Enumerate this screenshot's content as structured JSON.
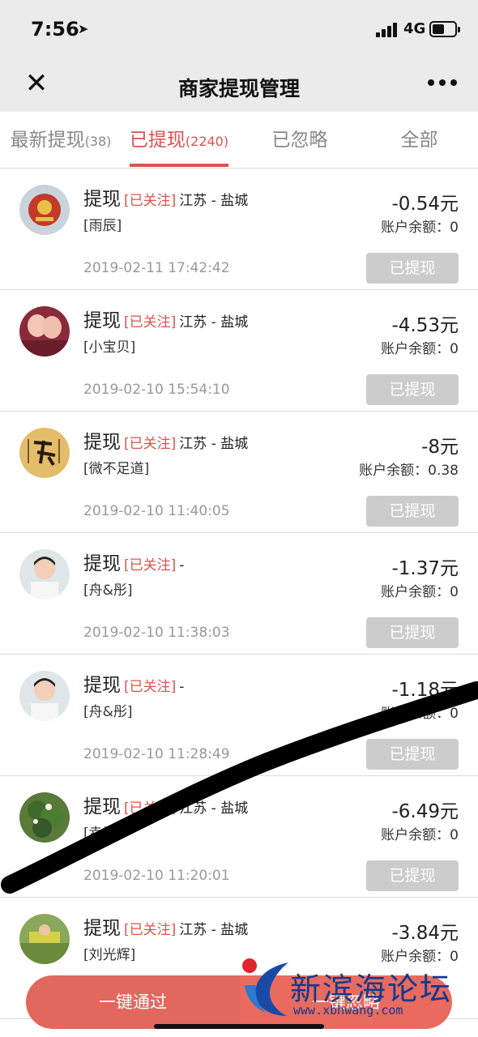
{
  "status_bar": {
    "time": "7:56",
    "network": "4G"
  },
  "nav": {
    "title": "商家提现管理"
  },
  "tabs": [
    {
      "label": "最新提现",
      "count": "(38)",
      "active": false
    },
    {
      "label": "已提现",
      "count": "(2240)",
      "active": true
    },
    {
      "label": "已忽略",
      "count": "",
      "active": false
    },
    {
      "label": "全部",
      "count": "",
      "active": false
    }
  ],
  "records": [
    {
      "title": "提现",
      "tag": "[已关注]",
      "location": "江苏 - 盐城",
      "nickname": "[雨辰]",
      "amount": "-0.54元",
      "balance": "账户余额：0",
      "date": "2019-02-11 17:42:42",
      "status": "已提现"
    },
    {
      "title": "提现",
      "tag": "[已关注]",
      "location": "江苏 - 盐城",
      "nickname": "[小宝贝]",
      "amount": "-4.53元",
      "balance": "账户余额：0",
      "date": "2019-02-10 15:54:10",
      "status": "已提现"
    },
    {
      "title": "提现",
      "tag": "[已关注]",
      "location": "江苏 - 盐城",
      "nickname": "[微不足道]",
      "amount": "-8元",
      "balance": "账户余额：0.38",
      "date": "2019-02-10 11:40:05",
      "status": "已提现"
    },
    {
      "title": "提现",
      "tag": "[已关注]",
      "location": "-",
      "nickname": "[舟&彤]",
      "amount": "-1.37元",
      "balance": "账户余额：0",
      "date": "2019-02-10 11:38:03",
      "status": "已提现"
    },
    {
      "title": "提现",
      "tag": "[已关注]",
      "location": "-",
      "nickname": "[舟&彤]",
      "amount": "-1.18元",
      "balance": "账户余额：0",
      "date": "2019-02-10 11:28:49",
      "status": "已提现"
    },
    {
      "title": "提现",
      "tag": "[已关注]",
      "location": "江苏 - 盐城",
      "nickname": "[幸福]",
      "amount": "-6.49元",
      "balance": "账户余额：0",
      "date": "2019-02-10 11:20:01",
      "status": "已提现"
    },
    {
      "title": "提现",
      "tag": "[已关注]",
      "location": "江苏 - 盐城",
      "nickname": "[刘光辉]",
      "amount": "-3.84元",
      "balance": "账户余额：0",
      "date": "",
      "status": ""
    }
  ],
  "actions": {
    "approve_all": "一键通过",
    "ignore_all": "一键忽略"
  },
  "watermark": {
    "name": "新滨海论坛",
    "url": "www.xbhwang.com"
  },
  "colors": {
    "accent": "#d9544d",
    "button_red": "#e2675d",
    "done_gray": "#cccccc",
    "bar_bg": "#ebebeb"
  }
}
